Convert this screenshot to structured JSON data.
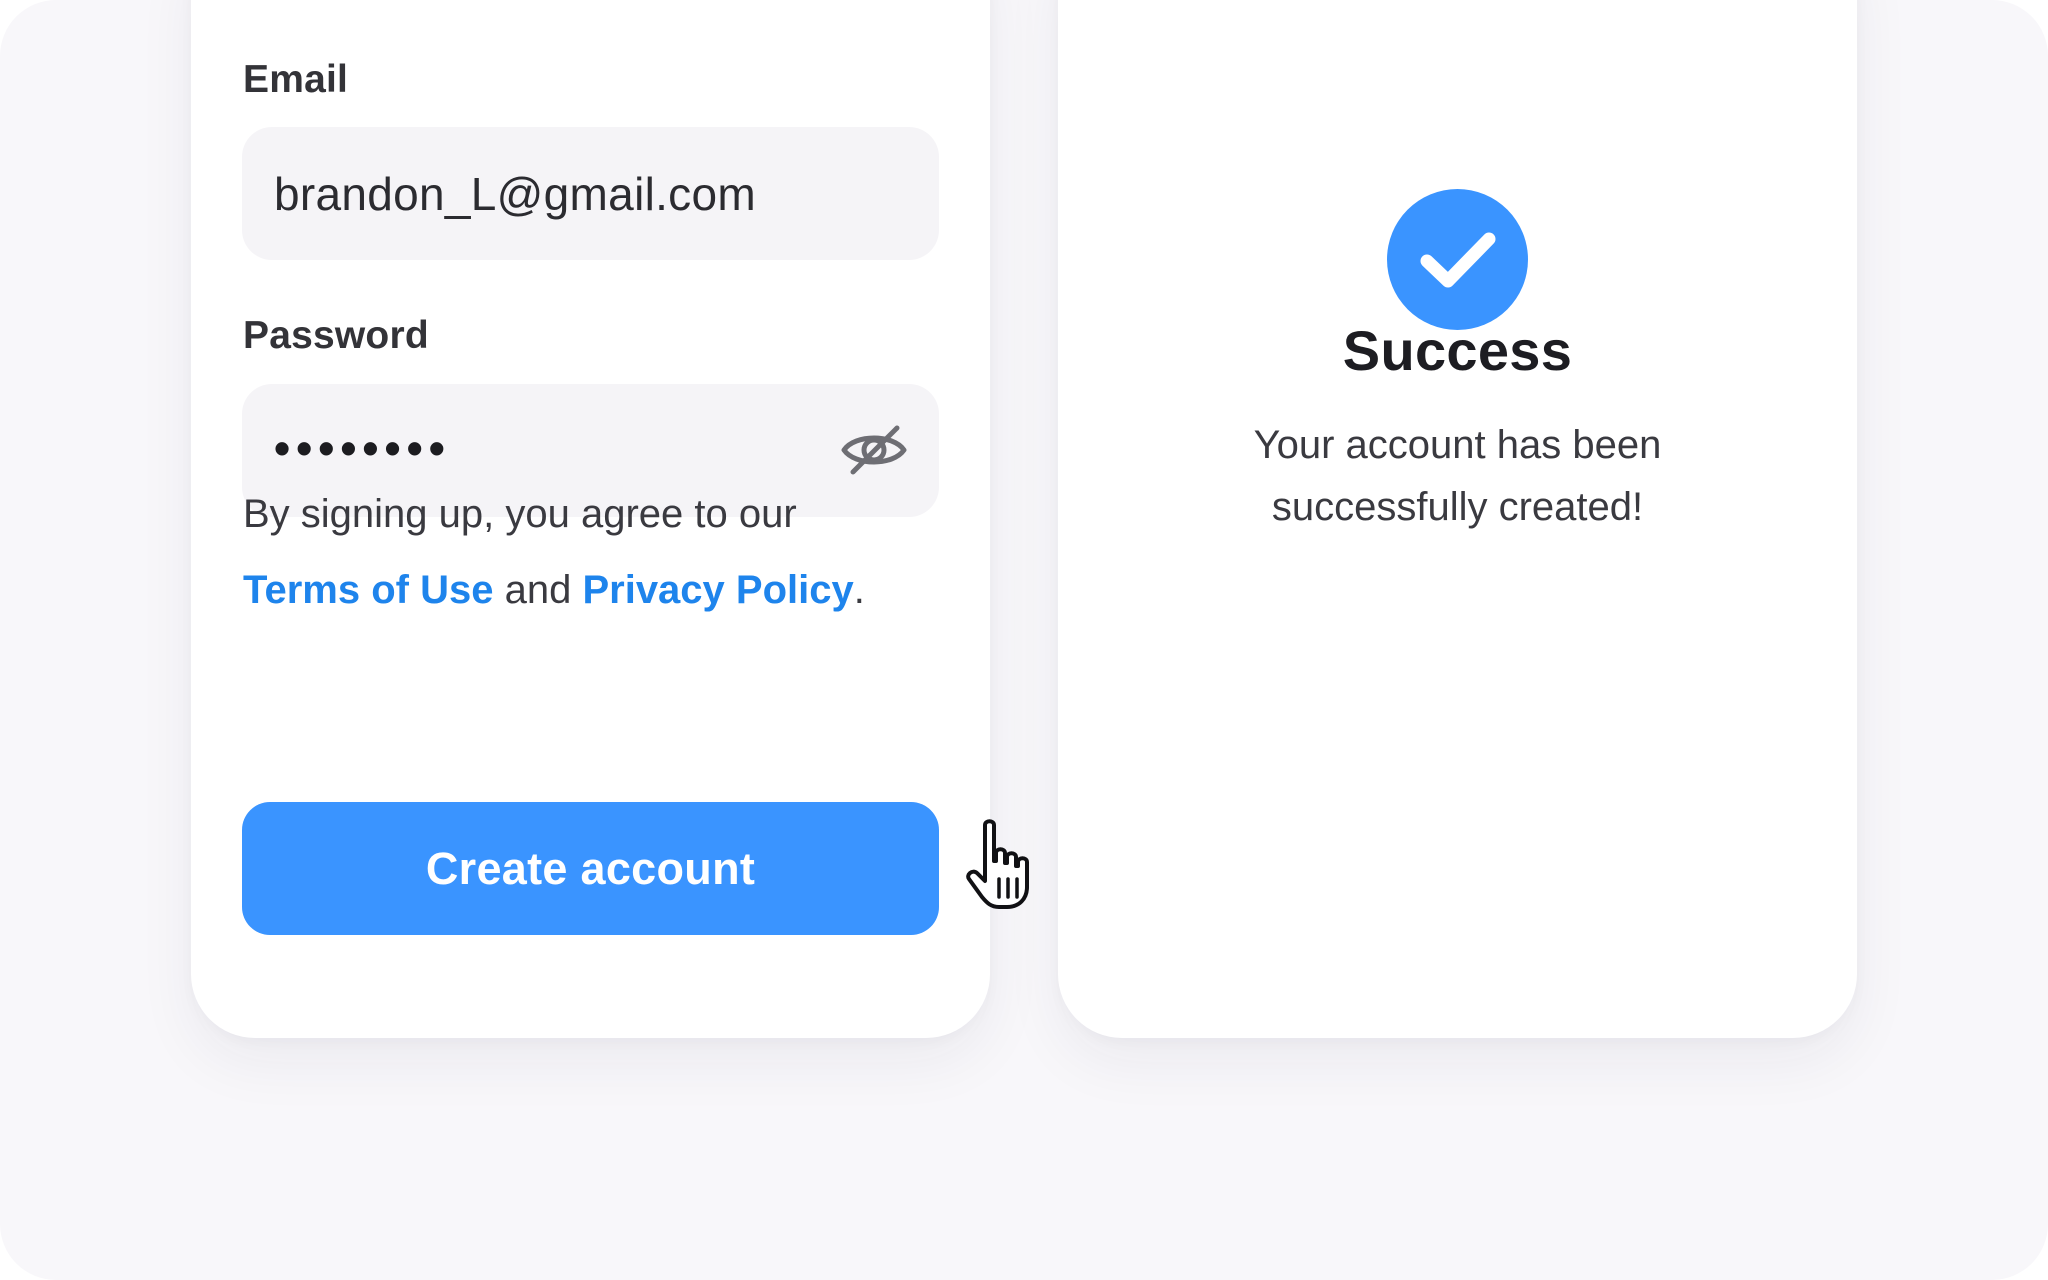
{
  "signup": {
    "email_label": "Email",
    "email_value": "brandon_L@gmail.com",
    "password_label": "Password",
    "password_value": "••••••••",
    "terms_prefix": "By signing up, you agree to our",
    "terms_link": "Terms of Use",
    "terms_and": "and",
    "privacy_link": "Privacy Policy",
    "terms_suffix": ".",
    "create_button_label": "Create account"
  },
  "success": {
    "title": "Success",
    "message_line1": "Your account has been",
    "message_line2": "successfully created!"
  },
  "icons": {
    "password_toggle": "eye-off-icon",
    "success": "checkmark-circle-icon",
    "cursor": "hand-pointer-cursor"
  },
  "colors": {
    "accent": "#3a94ff",
    "link": "#1e84ec",
    "input_background": "#f5f4f7",
    "page_background": "#f8f7fa"
  }
}
